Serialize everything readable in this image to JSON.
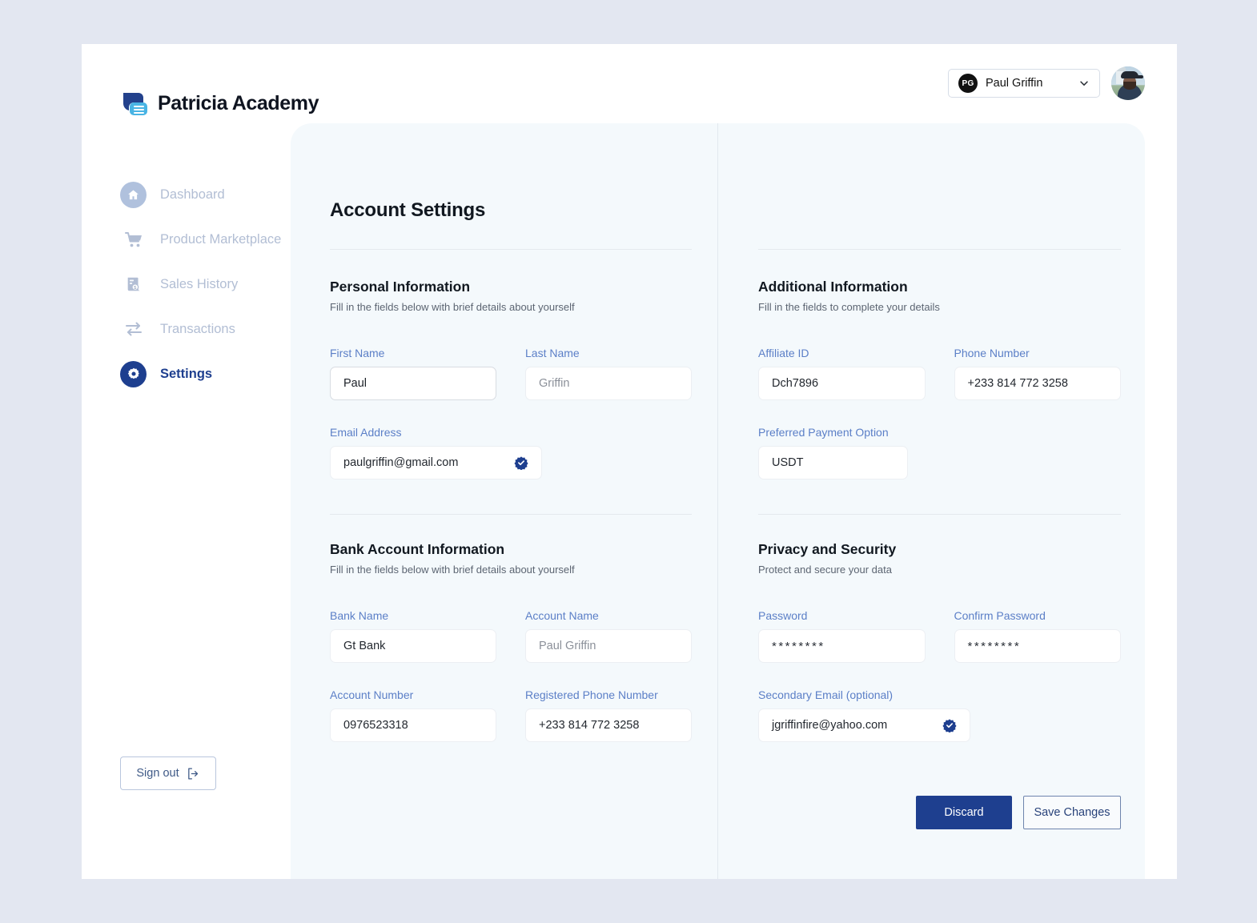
{
  "brand": {
    "name": "Patricia Academy",
    "logo_icon": "patricia-academy-logo",
    "dark_blue": "#1e3f8f",
    "light_blue": "#3aa7dd"
  },
  "header": {
    "user_initials": "PG",
    "user_name": "Paul Griffin",
    "chevron_icon": "chevron-down-icon",
    "avatar_icon": "user-avatar-photo"
  },
  "sidebar": {
    "items": [
      {
        "label": "Dashboard",
        "icon": "home-icon",
        "active": false
      },
      {
        "label": "Product Marketplace",
        "icon": "shopping-cart-icon",
        "active": false
      },
      {
        "label": "Sales History",
        "icon": "receipt-icon",
        "active": false
      },
      {
        "label": "Transactions",
        "icon": "exchange-arrows-icon",
        "active": false
      },
      {
        "label": "Settings",
        "icon": "gear-icon",
        "active": true
      }
    ],
    "signout": {
      "label": "Sign out",
      "icon": "logout-icon"
    }
  },
  "main": {
    "title": "Account Settings",
    "sections": {
      "personal": {
        "heading": "Personal Information",
        "subtext": "Fill in the fields below with brief details about yourself",
        "first_name": {
          "label": "First Name",
          "value": "Paul"
        },
        "last_name": {
          "label": "Last Name",
          "value": "Griffin"
        },
        "email": {
          "label": "Email Address",
          "value": "paulgriffin@gmail.com",
          "verified_icon": "verified-badge-icon"
        }
      },
      "additional": {
        "heading": "Additional Information",
        "subtext": "Fill in the fields to complete your details",
        "affiliate_id": {
          "label": "Affiliate ID",
          "value": "Dch7896"
        },
        "phone_number": {
          "label": "Phone Number",
          "value": "+233 814 772 3258"
        },
        "payment_option": {
          "label": "Preferred Payment Option",
          "value": "USDT"
        }
      },
      "bank": {
        "heading": "Bank Account Information",
        "subtext": "Fill in the fields below with brief details about yourself",
        "bank_name": {
          "label": "Bank Name",
          "value": "Gt Bank"
        },
        "account_name": {
          "label": "Account Name",
          "value": "Paul Griffin"
        },
        "account_number": {
          "label": "Account Number",
          "value": "0976523318"
        },
        "reg_phone": {
          "label": "Registered Phone Number",
          "value": "+233 814 772 3258"
        }
      },
      "privacy": {
        "heading": "Privacy and Security",
        "subtext": "Protect and secure your data",
        "password": {
          "label": "Password",
          "value": "********"
        },
        "confirm_password": {
          "label": "Confirm Password",
          "value": "********"
        },
        "secondary_email": {
          "label": "Secondary Email (optional)",
          "value": "jgriffinfire@yahoo.com",
          "verified_icon": "verified-badge-icon"
        }
      }
    },
    "actions": {
      "discard": "Discard",
      "save": "Save Changes"
    }
  }
}
